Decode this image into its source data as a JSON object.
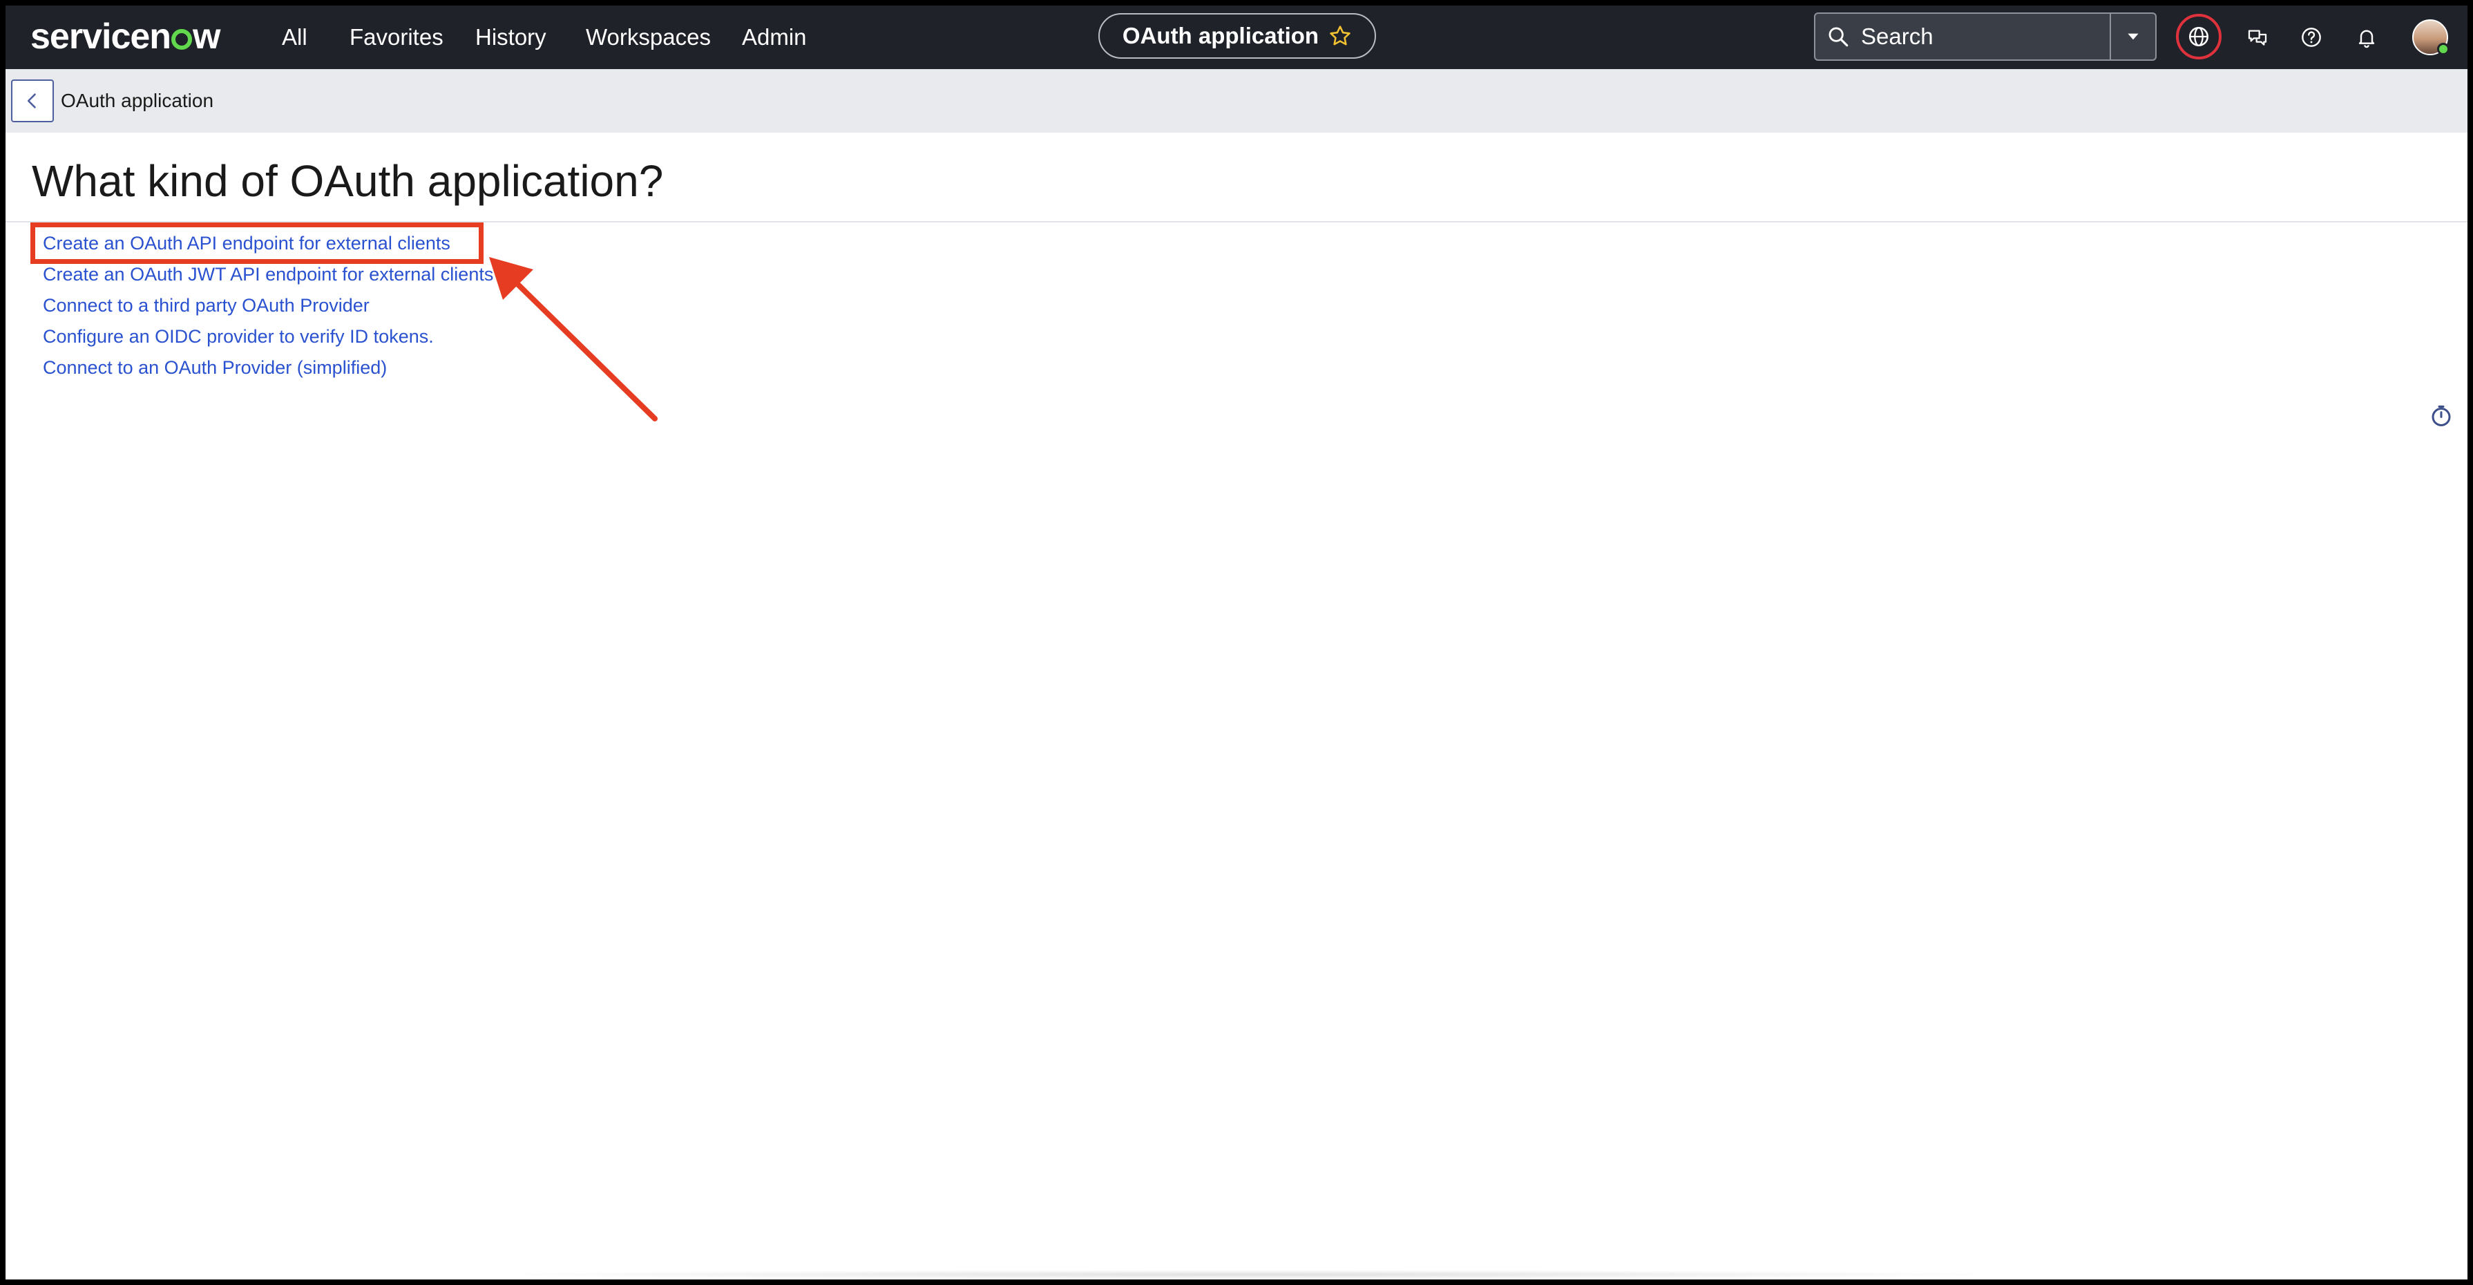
{
  "brand": {
    "logo_text_before": "servicen",
    "logo_text_after": "w",
    "accent_color": "#62d84e"
  },
  "nav": {
    "items": [
      "All",
      "Favorites",
      "History",
      "Workspaces",
      "Admin"
    ]
  },
  "context": {
    "title": "OAuth application",
    "icon": "star-icon"
  },
  "search": {
    "placeholder": "Search",
    "icon": "search-icon",
    "dropdown_icon": "caret-down-icon"
  },
  "header_icons": [
    "globe-icon",
    "chat-icon",
    "help-icon",
    "bell-icon",
    "avatar"
  ],
  "subheader": {
    "title": "OAuth application",
    "back_icon": "chevron-left-icon"
  },
  "main": {
    "title": "What kind of OAuth application?",
    "options": [
      "Create an OAuth API endpoint for external clients",
      "Create an OAuth JWT API endpoint for external clients",
      "Connect to a third party OAuth Provider",
      "Configure an OIDC provider to verify ID tokens.",
      "Connect to an OAuth Provider (simplified)"
    ]
  },
  "annotation": {
    "highlight_color": "#e63c22",
    "highlighted_option_index": 0
  },
  "colors": {
    "topnav_bg": "#1f2228",
    "link": "#2a52d0",
    "globe_ring": "#e0323c"
  }
}
